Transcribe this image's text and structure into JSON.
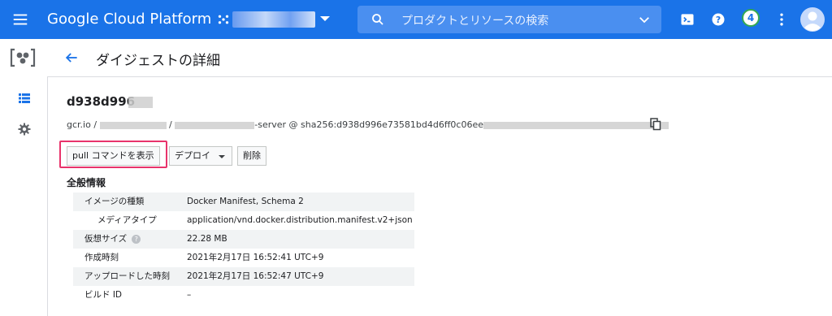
{
  "header": {
    "brand": "Google Cloud Platform",
    "search_placeholder": "プロダクトとリソースの検索",
    "notification_count": "4"
  },
  "page": {
    "title": "ダイジェストの詳細"
  },
  "digest": {
    "short_id": "d938d996",
    "path_prefix": "gcr.io /",
    "path_sep": "/",
    "server_suffix": "-server @ sha256:d938d996e73581bd4d6ff0c06ee"
  },
  "actions": {
    "pull_label": "pull コマンドを表示",
    "deploy_label": "デプロイ",
    "delete_label": "削除"
  },
  "general": {
    "section_title": "全般情報",
    "rows": [
      {
        "label": "イメージの種類",
        "value": "Docker Manifest, Schema 2"
      },
      {
        "label": "メディアタイプ",
        "value": "application/vnd.docker.distribution.manifest.v2+json"
      },
      {
        "label": "仮想サイズ",
        "value": "22.28 MB"
      },
      {
        "label": "作成時刻",
        "value": "2021年2月17日 16:52:41 UTC+9"
      },
      {
        "label": "アップロードした時刻",
        "value": "2021年2月17日 16:52:47 UTC+9"
      },
      {
        "label": "ビルド ID",
        "value": "–"
      }
    ],
    "help_glyph": "?"
  },
  "colors": {
    "header_blue": "#1a73e8",
    "highlight_pink": "#e8336b"
  }
}
